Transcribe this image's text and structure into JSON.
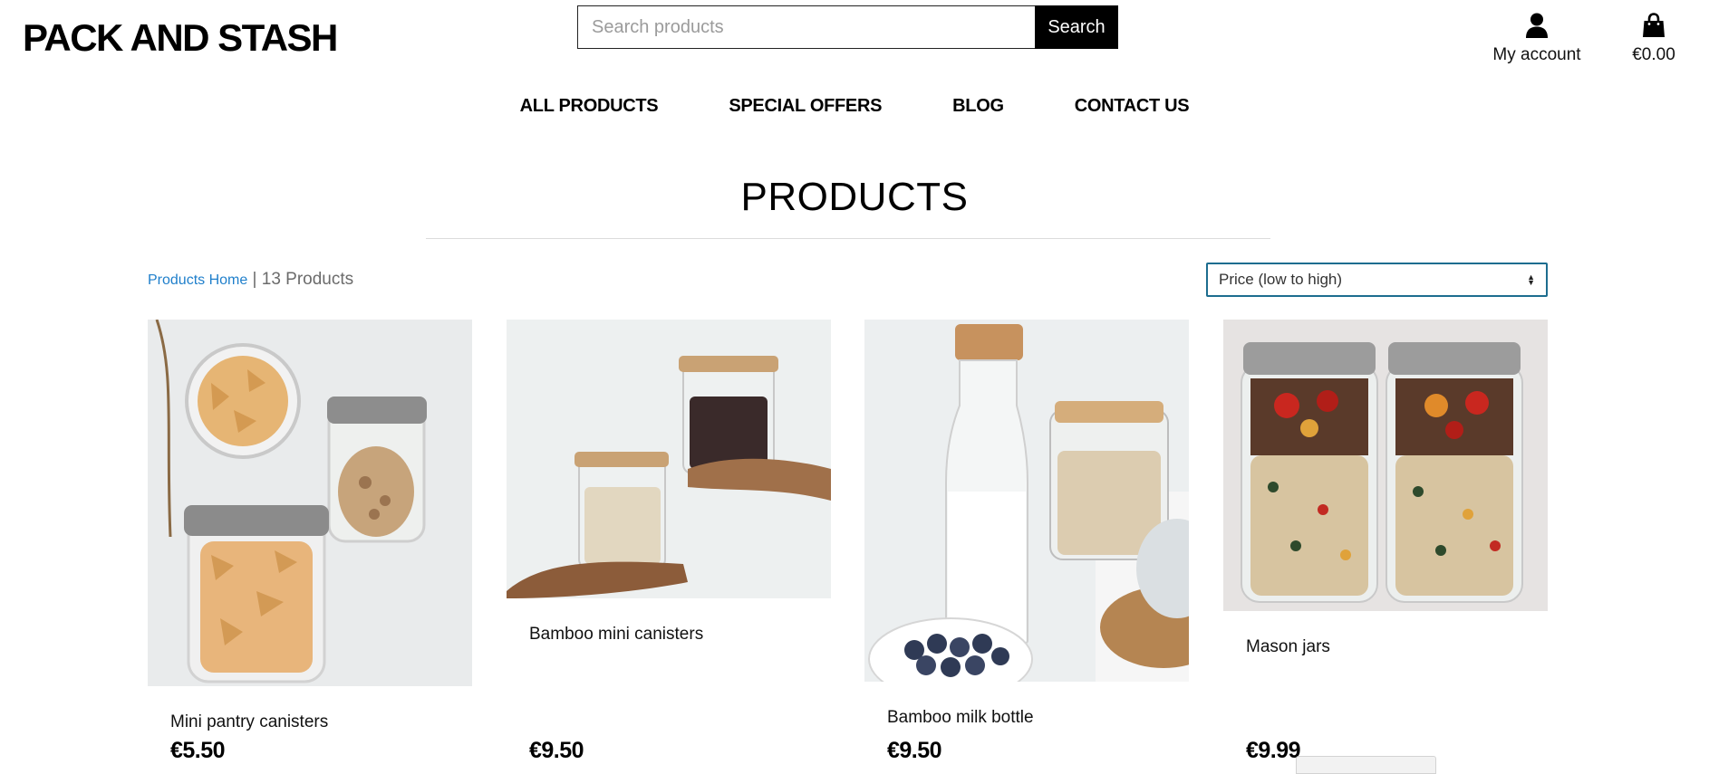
{
  "brand": {
    "logo_text": "PACK AND STASH"
  },
  "search": {
    "placeholder": "Search products",
    "value": "",
    "button_label": "Search"
  },
  "account": {
    "label": "My account",
    "icon": "user-icon"
  },
  "bag": {
    "total": "€0.00",
    "icon": "shopping-bag-icon"
  },
  "nav": {
    "items": [
      {
        "label": "ALL PRODUCTS"
      },
      {
        "label": "SPECIAL OFFERS"
      },
      {
        "label": "BLOG"
      },
      {
        "label": "CONTACT US"
      }
    ]
  },
  "page": {
    "title": "PRODUCTS"
  },
  "breadcrumb": {
    "home_label": "Products Home",
    "separator": "|",
    "count_label": "13 Products"
  },
  "sort": {
    "selected": "Price (low to high)"
  },
  "products": [
    {
      "name": "Mini pantry canisters",
      "price": "€5.50"
    },
    {
      "name": "Bamboo mini canisters",
      "price": "€9.50"
    },
    {
      "name": "Bamboo milk bottle",
      "price": "€9.50"
    },
    {
      "name": "Mason jars",
      "price": "€9.99"
    }
  ],
  "colors": {
    "accent_link": "#1f7fcb",
    "sort_border": "#1d6d8f",
    "button_bg": "#000000"
  }
}
